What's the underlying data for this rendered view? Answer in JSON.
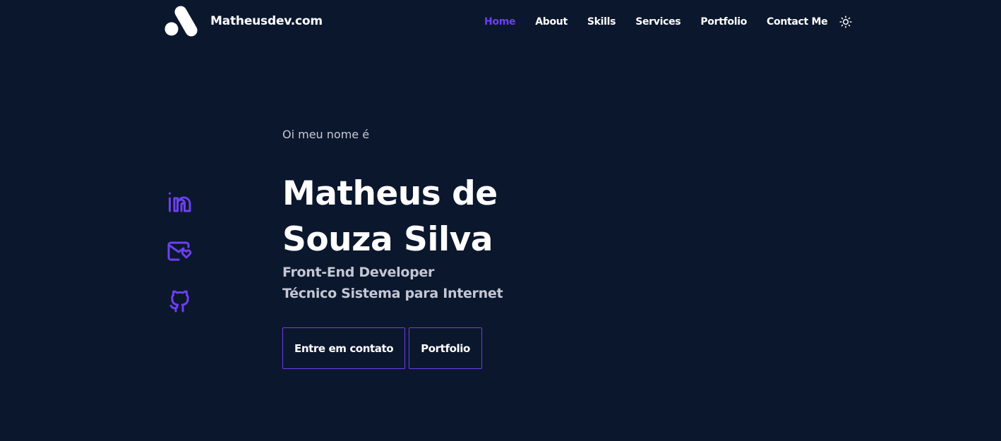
{
  "header": {
    "logo_text": "Matheusdev.com",
    "nav": [
      {
        "label": "Home",
        "active": true
      },
      {
        "label": "About",
        "active": false
      },
      {
        "label": "Skills",
        "active": false
      },
      {
        "label": "Services",
        "active": false
      },
      {
        "label": "Portfolio",
        "active": false
      },
      {
        "label": "Contact Me",
        "active": false
      }
    ],
    "theme_toggle_icon": "sun-icon"
  },
  "social": [
    {
      "icon": "linkedin-icon"
    },
    {
      "icon": "mail-heart-icon"
    },
    {
      "icon": "github-icon"
    }
  ],
  "hero": {
    "greeting": "Oi meu nome é",
    "name_line1": "Matheus de",
    "name_line2": "Souza Silva",
    "role1": "Front-End Developer",
    "role2": "Técnico Sistema para Internet",
    "btn_contact": "Entre em contato",
    "btn_portfolio": "Portfolio"
  },
  "colors": {
    "background": "#0b172d",
    "accent": "#6d3ff0",
    "text": "#ffffff",
    "muted": "#c4c7d4"
  }
}
